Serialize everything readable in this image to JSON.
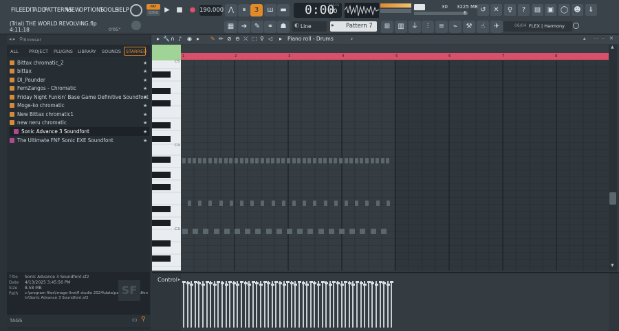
{
  "menu": [
    "FILE",
    "EDIT",
    "ADD",
    "PATTERNS",
    "VIEW",
    "OPTIONS",
    "TOOLS",
    "HELP"
  ],
  "project": {
    "title": "(Trial) THE WORLD REVOLVING.flp",
    "time": "4:11:18",
    "cpu_time": "0'05\""
  },
  "transport": {
    "pat_label": "PAT",
    "song_label": "SONG",
    "tempo": "190.000",
    "time_display": "0:00",
    "time_sub": "00",
    "time_unit": "M:S:CS"
  },
  "monitor": {
    "voices": "30",
    "memory": "3225 MB",
    "cpu": "6"
  },
  "toolbar2": {
    "snap": "Line",
    "pattern": "Pattern 7",
    "plugin_counter": "06/04",
    "plugin": "FLEX | Harmony"
  },
  "browser": {
    "title": "Browser",
    "tabs": [
      "ALL",
      "PROJECT",
      "PLUGINS",
      "LIBRARY",
      "SOUNDS",
      "STARRED"
    ],
    "active_tab": "STARRED",
    "items": [
      {
        "label": "Bittax chromatic_2",
        "type": "folder"
      },
      {
        "label": "bittax",
        "type": "folder"
      },
      {
        "label": "DI_Pounder",
        "type": "folder"
      },
      {
        "label": "FemZangos - Chromatic",
        "type": "folder"
      },
      {
        "label": "Friday Night Funkin' Base Game Definitive Soundfont",
        "type": "folder"
      },
      {
        "label": "Moge-ko chromatic",
        "type": "folder"
      },
      {
        "label": "New Bittax chromatic1",
        "type": "folder"
      },
      {
        "label": "new neru chromatic",
        "type": "folder"
      },
      {
        "label": "Sonic Advance 3 Soundfont",
        "type": "soundfont"
      },
      {
        "label": "The Ultimate FNF Sonic EXE Soundfont",
        "type": "soundfont"
      }
    ],
    "info": {
      "title_label": "Title",
      "title_value": "Sonic Advance 3 Soundfont.sf2",
      "date_label": "Date",
      "date_value": "4/13/2025 3:45:56 PM",
      "size_label": "Size",
      "size_value": "8.58 MB",
      "path_label": "Path",
      "path_value": "c:\\program files\\image-line\\fl studio 2024\\data\\patches\\soundfonts\\Sonic Advance 3 Soundfont.sf2",
      "badge": "SF"
    },
    "tags_label": "TAGS"
  },
  "piano_roll": {
    "title": "Piano roll - Drums",
    "bars": [
      "1",
      "2",
      "3",
      "4",
      "5",
      "6",
      "7",
      "8"
    ],
    "octave_labels": [
      "C5",
      "C4",
      "C3"
    ],
    "control_label": "Control"
  },
  "colors": {
    "accent": "#e08a2a",
    "timeline": "#d8506a",
    "window_bg": "#323a40"
  }
}
